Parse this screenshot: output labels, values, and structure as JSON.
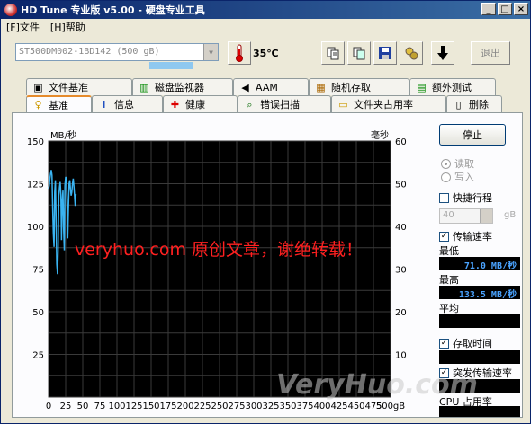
{
  "window": {
    "title": "HD Tune 专业版 v5.00 - 硬盘专业工具",
    "min": "_",
    "max": "□",
    "close": "×"
  },
  "menu": [
    {
      "label": "[F]文件"
    },
    {
      "label": "[H]帮助"
    }
  ],
  "toolbar": {
    "drive": "ST500DM002-1BD142 (500 gB)",
    "temperature": "35℃",
    "exit_label": "退出",
    "drive_busy_fraction": 0.22
  },
  "tabs_row1": [
    {
      "label": "文件基准",
      "icon": "file-benchmark-icon",
      "glyph": "?"
    },
    {
      "label": "磁盘监视器",
      "icon": "disk-monitor-icon",
      "glyph": "▥"
    },
    {
      "label": "AAM",
      "icon": "speaker-icon",
      "glyph": "◀"
    },
    {
      "label": "随机存取",
      "icon": "random-access-icon",
      "glyph": "▦"
    },
    {
      "label": "额外测试",
      "icon": "extra-tests-icon",
      "glyph": "▤"
    }
  ],
  "tabs_row2": [
    {
      "label": "基准",
      "icon": "benchmark-icon",
      "glyph": "♀"
    },
    {
      "label": "信息",
      "icon": "info-icon",
      "glyph": "i"
    },
    {
      "label": "健康",
      "icon": "health-cross-icon",
      "glyph": "✚"
    },
    {
      "label": "错误扫描",
      "icon": "magnifier-icon",
      "glyph": "⌕"
    },
    {
      "label": "文件夹占用率",
      "icon": "folder-icon",
      "glyph": "▭"
    },
    {
      "label": "删除",
      "icon": "trash-icon",
      "glyph": "▯"
    }
  ],
  "side": {
    "stop_label": "停止",
    "read_label": "读取",
    "write_label": "写入",
    "quick_label": "快捷行程",
    "quick_value": "40",
    "quick_unit": "gB",
    "transfer_label": "传输速率",
    "min_label": "最低",
    "min_value": "71.0 MB/秒",
    "max_label": "最高",
    "max_value": "133.5 MB/秒",
    "avg_label": "平均",
    "access_label": "存取时间",
    "burst_label": "突发传输速率",
    "cpu_label": "CPU 占用率"
  },
  "watermarks": {
    "red": "veryhuo.com 原创文章，谢绝转载！",
    "grey": "VeryHuo.com"
  },
  "chart_data": {
    "type": "line",
    "ylabel_left": "MB/秒",
    "ylabel_right": "毫秒",
    "y_ticks_left": [
      "150",
      "125",
      "100",
      "75",
      "50",
      "25"
    ],
    "y_ticks_right": [
      "60",
      "50",
      "40",
      "30",
      "20",
      "10"
    ],
    "x_ticks": [
      "0",
      "25",
      "50",
      "75",
      "100",
      "125",
      "150",
      "175",
      "200",
      "225",
      "250",
      "275",
      "300",
      "325",
      "350",
      "375",
      "400",
      "425",
      "450",
      "475",
      "500gB"
    ],
    "ylim": [
      0,
      150
    ],
    "xlim": [
      0,
      500
    ],
    "series": [
      {
        "color": "#3ab4f2",
        "x": [
          0,
          1,
          2,
          3,
          4,
          5,
          6,
          7,
          8,
          9,
          10,
          11,
          12,
          13,
          14,
          15,
          16,
          17,
          18,
          19,
          20,
          21,
          22,
          23,
          24,
          25,
          26,
          27,
          28,
          29,
          30,
          31,
          32,
          33,
          34,
          35,
          36,
          37,
          38,
          39,
          40
        ],
        "y": [
          122,
          124,
          128,
          131,
          133,
          130,
          110,
          96,
          88,
          120,
          127,
          102,
          78,
          72,
          85,
          118,
          123,
          126,
          119,
          92,
          115,
          121,
          99,
          86,
          124,
          129,
          128,
          117,
          93,
          109,
          125,
          127,
          122,
          118,
          120,
          125,
          128,
          124,
          118,
          112,
          119
        ]
      }
    ],
    "grid": true
  }
}
